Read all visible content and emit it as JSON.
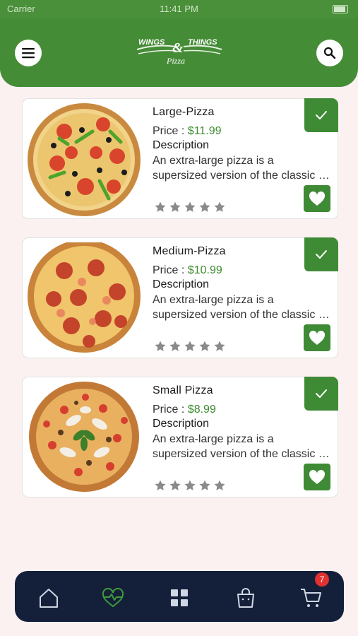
{
  "status_bar": {
    "carrier": "Carrier",
    "time": "11:41 PM"
  },
  "header": {
    "logo_top_left": "WINGS",
    "logo_amp": "&",
    "logo_top_right": "THINGS",
    "logo_sub": "Pizza"
  },
  "products": [
    {
      "title": "Large-Pizza",
      "price_label": "Price : ",
      "price": "$11.99",
      "desc_heading": "Description",
      "desc_line1": "An extra-large pizza is a",
      "desc_line2": "supersized version of the classic pizza",
      "rating": 0
    },
    {
      "title": "Medium-Pizza",
      "price_label": "Price : ",
      "price": "$10.99",
      "desc_heading": "Description",
      "desc_line1": "An extra-large pizza is a",
      "desc_line2": "supersized version of the classic pizza",
      "rating": 0
    },
    {
      "title": "Small Pizza",
      "price_label": "Price : ",
      "price": "$8.99",
      "desc_heading": "Description",
      "desc_line1": "An extra-large pizza is a",
      "desc_line2": "supersized version of the classic pizza",
      "rating": 0
    }
  ],
  "bottom_nav": {
    "items": [
      "home-icon",
      "favorites-icon",
      "categories-icon",
      "bag-icon",
      "cart-icon"
    ],
    "active": "favorites-icon",
    "cart_badge": "7"
  },
  "colors": {
    "brand_green": "#458c37",
    "nav_bg": "#14203a",
    "badge_red": "#e13131",
    "price_green": "#3d8b2f"
  }
}
